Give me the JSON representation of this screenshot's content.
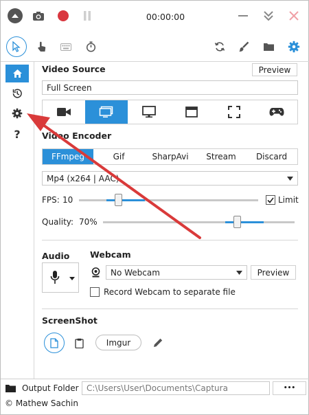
{
  "titlebar": {
    "timer": "00:00:00",
    "icons": [
      "menu-up-icon",
      "camera-icon",
      "record-icon",
      "pause-icon",
      "minimize-icon",
      "collapse-icon",
      "close-icon"
    ]
  },
  "toolbar": {
    "tools": [
      "cursor-icon",
      "click-icon",
      "keyboard-icon",
      "timer-icon"
    ],
    "actions": [
      "refresh-icon",
      "brush-icon",
      "folder-icon",
      "gear-icon"
    ]
  },
  "sidebar": {
    "items": [
      "home-icon",
      "history-icon",
      "settings-icon",
      "help-icon"
    ],
    "help_label": "?"
  },
  "video_source": {
    "title": "Video Source",
    "preview_label": "Preview",
    "value": "Full Screen",
    "sources": [
      "camera-video-icon",
      "full-screen-icon",
      "monitor-icon",
      "window-icon",
      "region-icon",
      "gamepad-icon"
    ],
    "selected_index": 1
  },
  "video_encoder": {
    "title": "Video Encoder",
    "tabs": [
      "FFmpeg",
      "Gif",
      "SharpAvi",
      "Stream",
      "Discard"
    ],
    "selected_tab": 0,
    "codec": "Mp4 (x264 | AAC)",
    "fps_label": "FPS:",
    "fps_value": "10",
    "fps_level": 0.22,
    "limit_label": "Limit",
    "limit_checked": true,
    "quality_label": "Quality:",
    "quality_value": "70%",
    "quality_level": 0.7
  },
  "audio": {
    "title": "Audio"
  },
  "webcam": {
    "title": "Webcam",
    "value": "No Webcam",
    "preview_label": "Preview",
    "separate_file_label": "Record Webcam to separate file"
  },
  "screenshot": {
    "title": "ScreenShot",
    "imgur_label": "Imgur"
  },
  "output": {
    "label": "Output Folder",
    "path": "C:\\Users\\User\\Documents\\Captura",
    "more_label": "•••"
  },
  "footer": {
    "author": "© Mathew Sachin"
  },
  "colors": {
    "accent": "#2b90d9",
    "record": "#d9373f",
    "annotation_arrow": "#d93a3a",
    "icon_gray": "#555555",
    "disabled_gray": "#b5b5b5"
  }
}
